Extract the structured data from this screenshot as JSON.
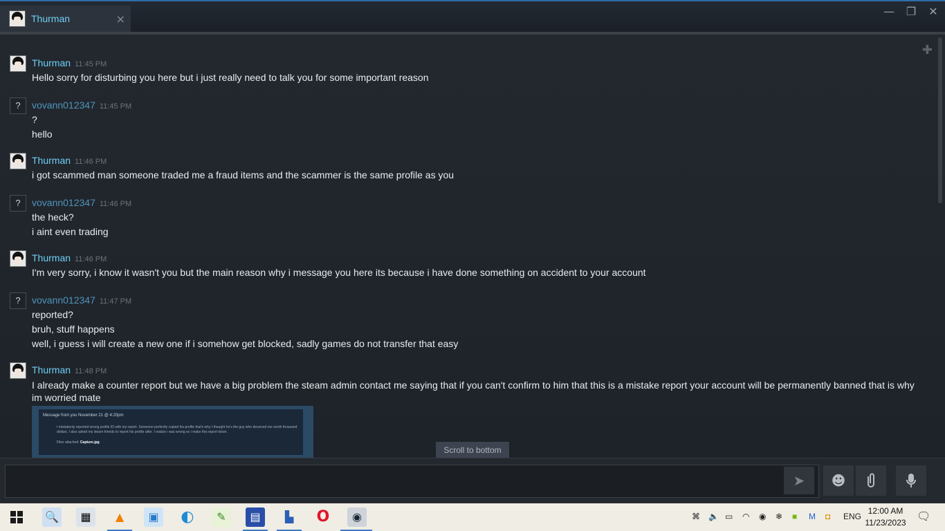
{
  "tab": {
    "name": "Thurman",
    "close_glyph": "×"
  },
  "window_controls": {
    "minimize": "—",
    "restore": "❐",
    "close": "✕"
  },
  "messages": [
    {
      "user": "Thurman",
      "time": "11:45 PM",
      "lines": [
        "Hello sorry for disturbing you here but i just really need to talk you for some important reason"
      ]
    },
    {
      "user": "vovann012347",
      "time": "11:45 PM",
      "lines": [
        "?",
        "hello"
      ]
    },
    {
      "user": "Thurman",
      "time": "11:46 PM",
      "lines": [
        "i got scammed man someone traded me a fraud items and the scammer is the same profile as you"
      ]
    },
    {
      "user": "vovann012347",
      "time": "11:46 PM",
      "lines": [
        "the heck?",
        "i aint even trading"
      ]
    },
    {
      "user": "Thurman",
      "time": "11:46 PM",
      "lines": [
        "I'm very sorry, i know it wasn't you but the main reason why i message you here its because i have done something on accident to your account"
      ]
    },
    {
      "user": "vovann012347",
      "time": "11:47 PM",
      "lines": [
        "reported?",
        "bruh, stuff happens",
        "well, i guess i will create a new one if i somehow get blocked, sadly games do not transfer that easy"
      ]
    },
    {
      "user": "Thurman",
      "time": "11:48 PM",
      "lines": [
        "I already make a counter report but we have a big problem the steam admin contact me saying that if you can't confirm to him that this is a mistake report your account will be permanently banned that is why im worried mate"
      ]
    }
  ],
  "unknown_avatar": "?",
  "attachment": {
    "header": "Message from you November 21 @ 4:20pm",
    "body": "I mistakenly reported wrong profile ID with my report. Someone perfectly copied his profile that's why I thought he's the guy who deceived me worth thousand dollars. I also asked my steam friends to report his profile after. I realize i was wrong so i make this report ticket.",
    "files_label": "Files attached:",
    "file_name": "Capture.jpg"
  },
  "scroll_to_bottom": "Scroll to bottom",
  "composer": {
    "placeholder": "",
    "send_glyph": "➤",
    "emoji_glyph": "☻",
    "attach_glyph": "⌒",
    "voice_glyph": "🎙"
  },
  "taskbar": {
    "icons": [
      "windows-start",
      "network-tool",
      "image-viewer",
      "vlc",
      "control-panel",
      "edge",
      "notepad",
      "floppy",
      "remote-desktop",
      "opera",
      "steam"
    ],
    "lang": "ENG",
    "time": "12:00 AM",
    "date": "11/23/2023"
  },
  "colors": {
    "accent": "#6dcff6",
    "background": "#1e2329"
  }
}
